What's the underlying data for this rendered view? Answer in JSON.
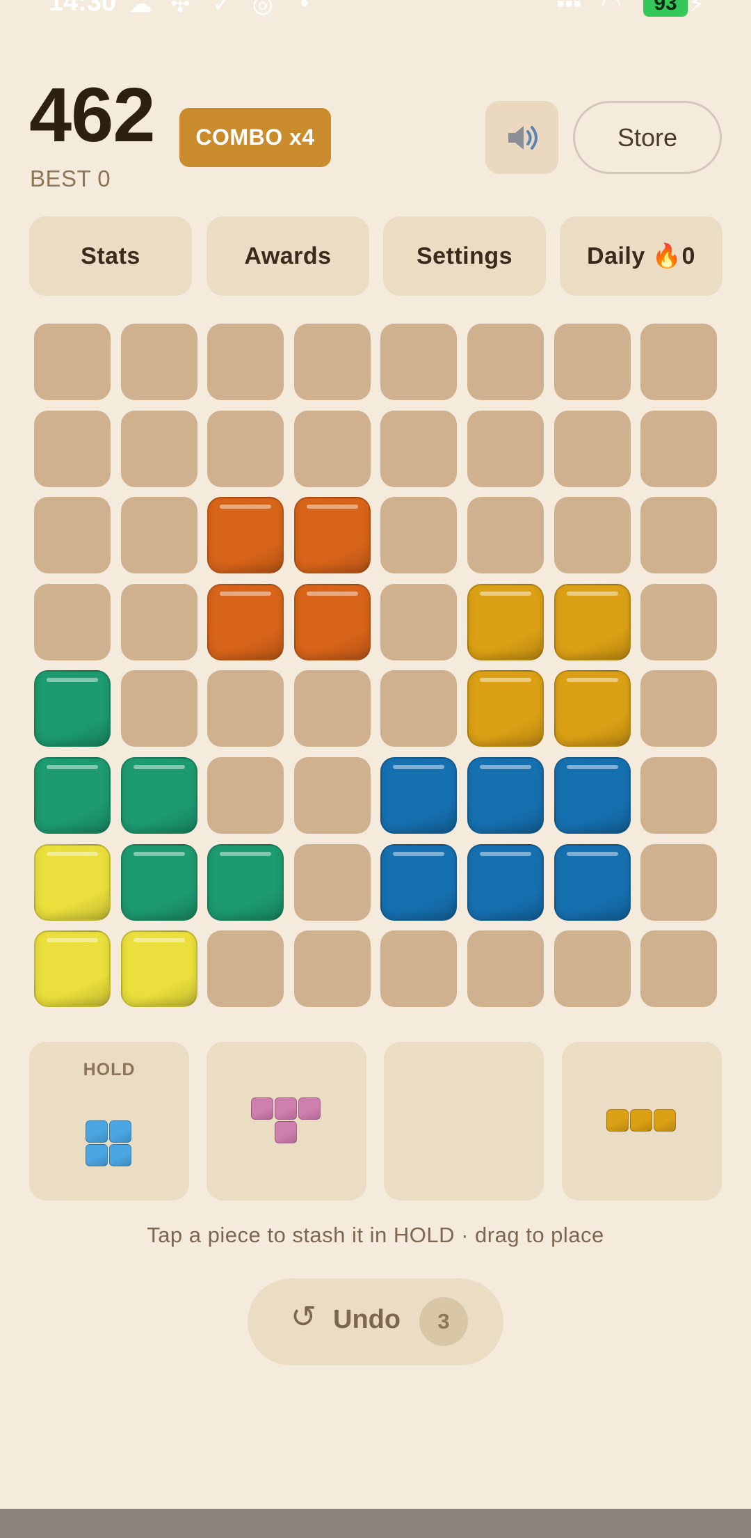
{
  "status_bar": {
    "time": "14:30",
    "icons": [
      "cloud-icon",
      "fan-icon",
      "check-circle-icon",
      "target-icon",
      "dot-icon"
    ],
    "battery": "93"
  },
  "header": {
    "score": "462",
    "best": "BEST 0",
    "combo": "COMBO x4",
    "sound_icon": "speaker-icon",
    "store_label": "Store"
  },
  "nav": [
    {
      "label": "Stats"
    },
    {
      "label": "Awards"
    },
    {
      "label": "Settings"
    },
    {
      "label": "Daily 🔥0"
    }
  ],
  "colors": {
    "empty": "#cfb18f",
    "orange": "#d8641a",
    "amber": "#dba015",
    "green": "#1d9a70",
    "blue": "#1670b0",
    "yellow": "#eadf3c",
    "pink": "#cf7fae",
    "lightblue": "#4aa6e2"
  },
  "board": {
    "rows": [
      [
        "",
        "",
        "",
        "",
        "",
        "",
        "",
        ""
      ],
      [
        "",
        "",
        "",
        "",
        "",
        "",
        "",
        ""
      ],
      [
        "",
        "",
        "orange",
        "orange",
        "",
        "",
        "",
        ""
      ],
      [
        "",
        "",
        "orange",
        "orange",
        "",
        "amber",
        "amber",
        ""
      ],
      [
        "green",
        "",
        "",
        "",
        "",
        "amber",
        "amber",
        ""
      ],
      [
        "green",
        "green",
        "",
        "",
        "blue",
        "blue",
        "blue",
        ""
      ],
      [
        "yellow",
        "green",
        "green",
        "",
        "blue",
        "blue",
        "blue",
        ""
      ],
      [
        "yellow",
        "yellow",
        "",
        "",
        "",
        "",
        "",
        ""
      ]
    ]
  },
  "tray": {
    "hold_label": "HOLD",
    "slots": [
      {
        "name": "hold",
        "color": "lightblue",
        "cells": [
          [
            0,
            0
          ],
          [
            1,
            0
          ],
          [
            0,
            1
          ],
          [
            1,
            1
          ]
        ]
      },
      {
        "name": "piece-1",
        "color": "pink",
        "cells": [
          [
            0,
            0
          ],
          [
            1,
            0
          ],
          [
            2,
            0
          ],
          [
            1,
            1
          ]
        ]
      },
      {
        "name": "piece-2",
        "color": "",
        "cells": []
      },
      {
        "name": "piece-3",
        "color": "amber",
        "cells": [
          [
            0,
            0
          ],
          [
            1,
            0
          ],
          [
            2,
            0
          ]
        ]
      }
    ]
  },
  "hint": "Tap a piece to stash it in HOLD · drag to place",
  "undo": {
    "label": "Undo",
    "icon": "undo-icon",
    "count": "3"
  }
}
